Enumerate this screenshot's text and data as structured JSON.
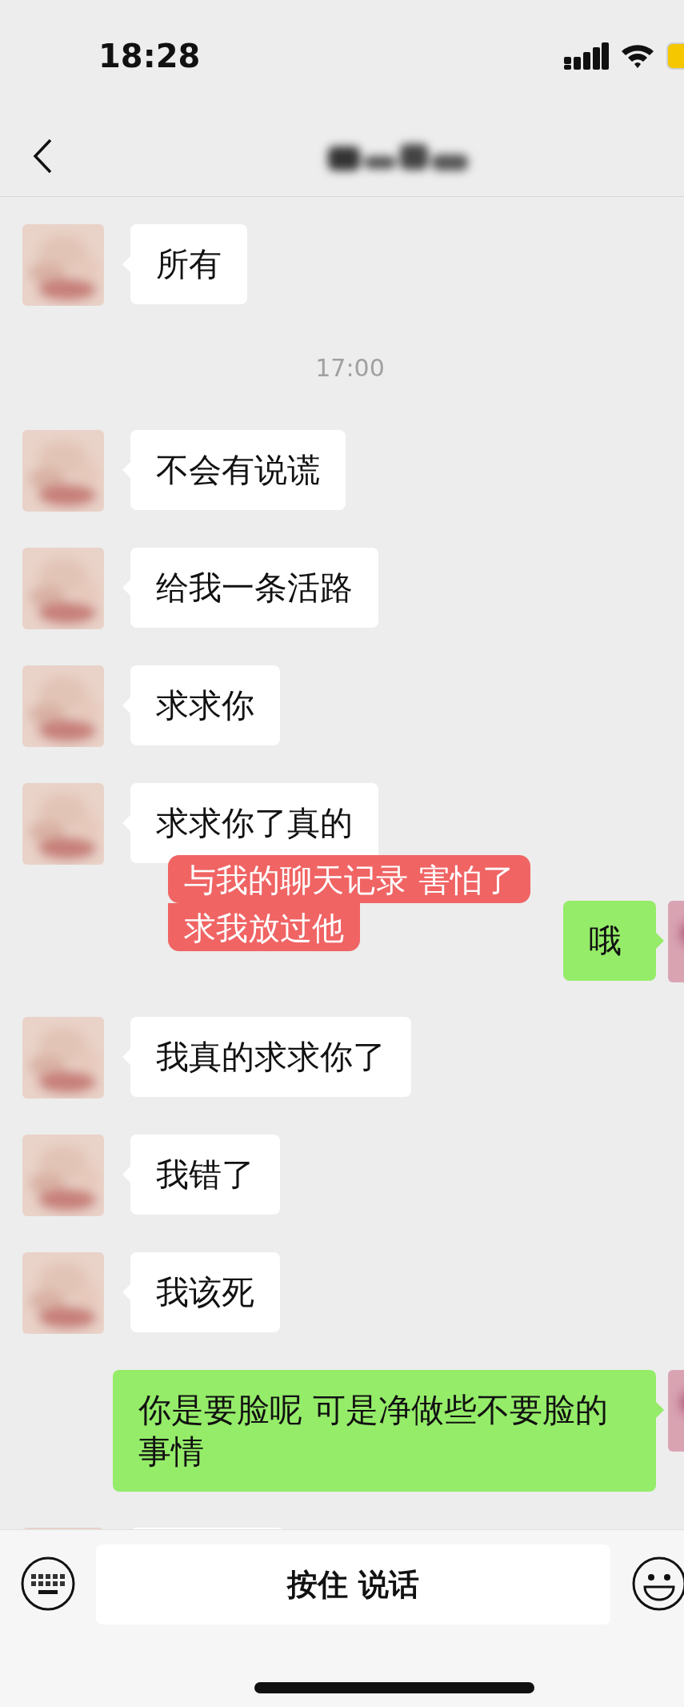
{
  "status_bar": {
    "time": "18:28"
  },
  "messages": [
    {
      "kind": "incoming",
      "text": "所有"
    },
    {
      "kind": "time",
      "text": "17:00"
    },
    {
      "kind": "incoming",
      "text": "不会有说谎"
    },
    {
      "kind": "incoming",
      "text": "给我一条活路"
    },
    {
      "kind": "incoming",
      "text": "求求你"
    },
    {
      "kind": "incoming",
      "text": "求求你了真的"
    },
    {
      "kind": "outgoing",
      "text": "哦",
      "annotation": [
        "与我的聊天记录 害怕了",
        "求我放过他"
      ]
    },
    {
      "kind": "incoming",
      "text": "我真的求求你了"
    },
    {
      "kind": "incoming",
      "text": "我错了"
    },
    {
      "kind": "incoming",
      "text": "我该死"
    },
    {
      "kind": "outgoing",
      "text": "你是要脸呢 可是净做些不要脸的事情"
    },
    {
      "kind": "incoming"
    }
  ],
  "input_bar": {
    "voice_button": "按住 说话"
  }
}
